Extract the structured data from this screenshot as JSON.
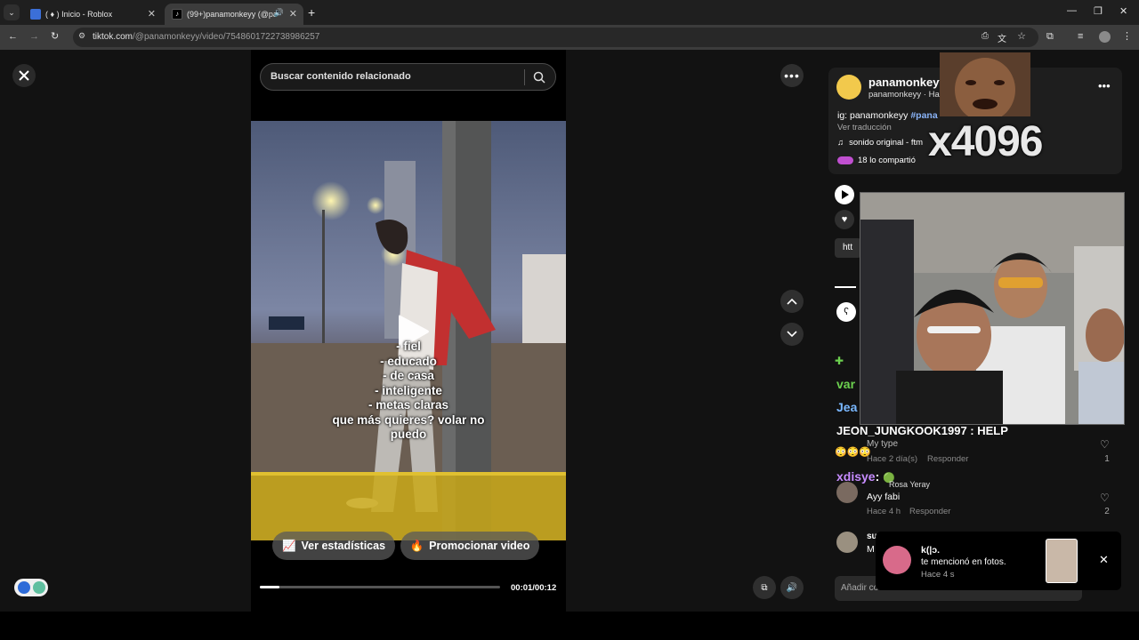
{
  "browser": {
    "tabs": [
      {
        "title": "( ♦ ) Inicio - Roblox",
        "active": false
      },
      {
        "title": "(99+)panamonkeyy (@pana",
        "active": true
      }
    ],
    "url_host": "tiktok.com",
    "url_path": "/@panamonkeyy/video/7548601722738986257"
  },
  "search": {
    "placeholder": "Buscar contenido relacionado"
  },
  "video": {
    "caption_lines": [
      "- fiel",
      "- educado",
      "- de casa",
      "- inteligente",
      "- metas claras",
      "que más quieres? volar no",
      "puedo"
    ],
    "time": "00:01/00:12",
    "progress": 0.08,
    "stats_button": "Ver estadísticas",
    "promote_button": "Promocionar video"
  },
  "post": {
    "username": "panamonkeyy",
    "subline": "panamonkeyy · Ha",
    "description_prefix": "ig: panamonkeyy ",
    "description_tag": "#pana",
    "translate": "Ver traducción",
    "sound": "sonido original - ftm",
    "shared": "18 lo compartió",
    "link_text": "htt"
  },
  "overlay": {
    "meme_text": "x4096",
    "chat": [
      {
        "user": "JEON_JUNGKOOK1997",
        "message": ": HELP"
      },
      {
        "user": "xdisye",
        "message": ":"
      }
    ],
    "chat_partial": [
      "var",
      "Jea"
    ]
  },
  "comments": [
    {
      "text": "My type",
      "time": "Hace 2 día(s)",
      "reply": "Responder",
      "likes": "1"
    },
    {
      "author": "Rosa Yeray",
      "text": "Ayy fabi",
      "time": "Hace 4 h",
      "reply": "Responder",
      "likes": "2"
    },
    {
      "author": "su",
      "text": "M"
    }
  ],
  "comment_input": {
    "placeholder": "Añadir co"
  },
  "notification": {
    "name": "k(|ɔ.",
    "text": "te mencionó en fotos.",
    "time": "Hace 4 s"
  },
  "colors": {
    "hashtag": "#8ab4f8",
    "accent_green": "#6cd04f",
    "pink": "#fe2c55"
  }
}
